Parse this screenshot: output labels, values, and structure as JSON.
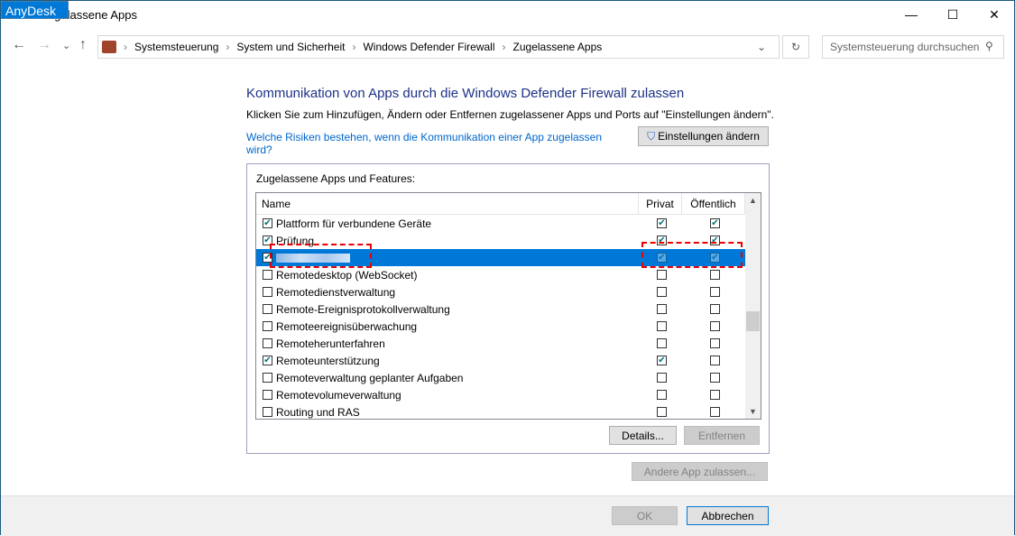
{
  "window": {
    "title": "Zugelassene Apps",
    "overlay": "AnyDesk",
    "min": "—",
    "max": "☐",
    "close": "✕"
  },
  "nav": {
    "back": "←",
    "forward": "→",
    "recent": "⌄",
    "up": "↑",
    "refresh": "↻"
  },
  "breadcrumb": [
    "Systemsteuerung",
    "System und Sicherheit",
    "Windows Defender Firewall",
    "Zugelassene Apps"
  ],
  "search": {
    "placeholder": "Systemsteuerung durchsuchen"
  },
  "main": {
    "heading": "Kommunikation von Apps durch die Windows Defender Firewall zulassen",
    "subtitle": "Klicken Sie zum Hinzufügen, Ändern oder Entfernen zugelassener Apps und Ports auf \"Einstellungen ändern\".",
    "risk_link": "Welche Risiken bestehen, wenn die Kommunikation einer App zugelassen wird?",
    "change_settings": "Einstellungen ändern",
    "group_label": "Zugelassene Apps und Features:",
    "columns": [
      "Name",
      "Privat",
      "Öffentlich"
    ],
    "rows": [
      {
        "name": "Plattform für verbundene Geräte",
        "enabled": true,
        "private": true,
        "public": true
      },
      {
        "name": "Prüfung",
        "enabled": true,
        "private": true,
        "public": true
      },
      {
        "name": "",
        "enabled": true,
        "private": true,
        "public": true,
        "selected": true
      },
      {
        "name": "Remotedesktop (WebSocket)",
        "enabled": false,
        "private": false,
        "public": false
      },
      {
        "name": "Remotedienstverwaltung",
        "enabled": false,
        "private": false,
        "public": false
      },
      {
        "name": "Remote-Ereignisprotokollverwaltung",
        "enabled": false,
        "private": false,
        "public": false
      },
      {
        "name": "Remoteereignisüberwachung",
        "enabled": false,
        "private": false,
        "public": false
      },
      {
        "name": "Remoteherunterfahren",
        "enabled": false,
        "private": false,
        "public": false
      },
      {
        "name": "Remoteunterstützung",
        "enabled": true,
        "private": true,
        "public": false
      },
      {
        "name": "Remoteverwaltung geplanter Aufgaben",
        "enabled": false,
        "private": false,
        "public": false
      },
      {
        "name": "Remotevolumeverwaltung",
        "enabled": false,
        "private": false,
        "public": false
      },
      {
        "name": "Routing und RAS",
        "enabled": false,
        "private": false,
        "public": false
      }
    ],
    "details": "Details...",
    "remove": "Entfernen",
    "add_app": "Andere App zulassen..."
  },
  "footer": {
    "ok": "OK",
    "cancel": "Abbrechen"
  }
}
